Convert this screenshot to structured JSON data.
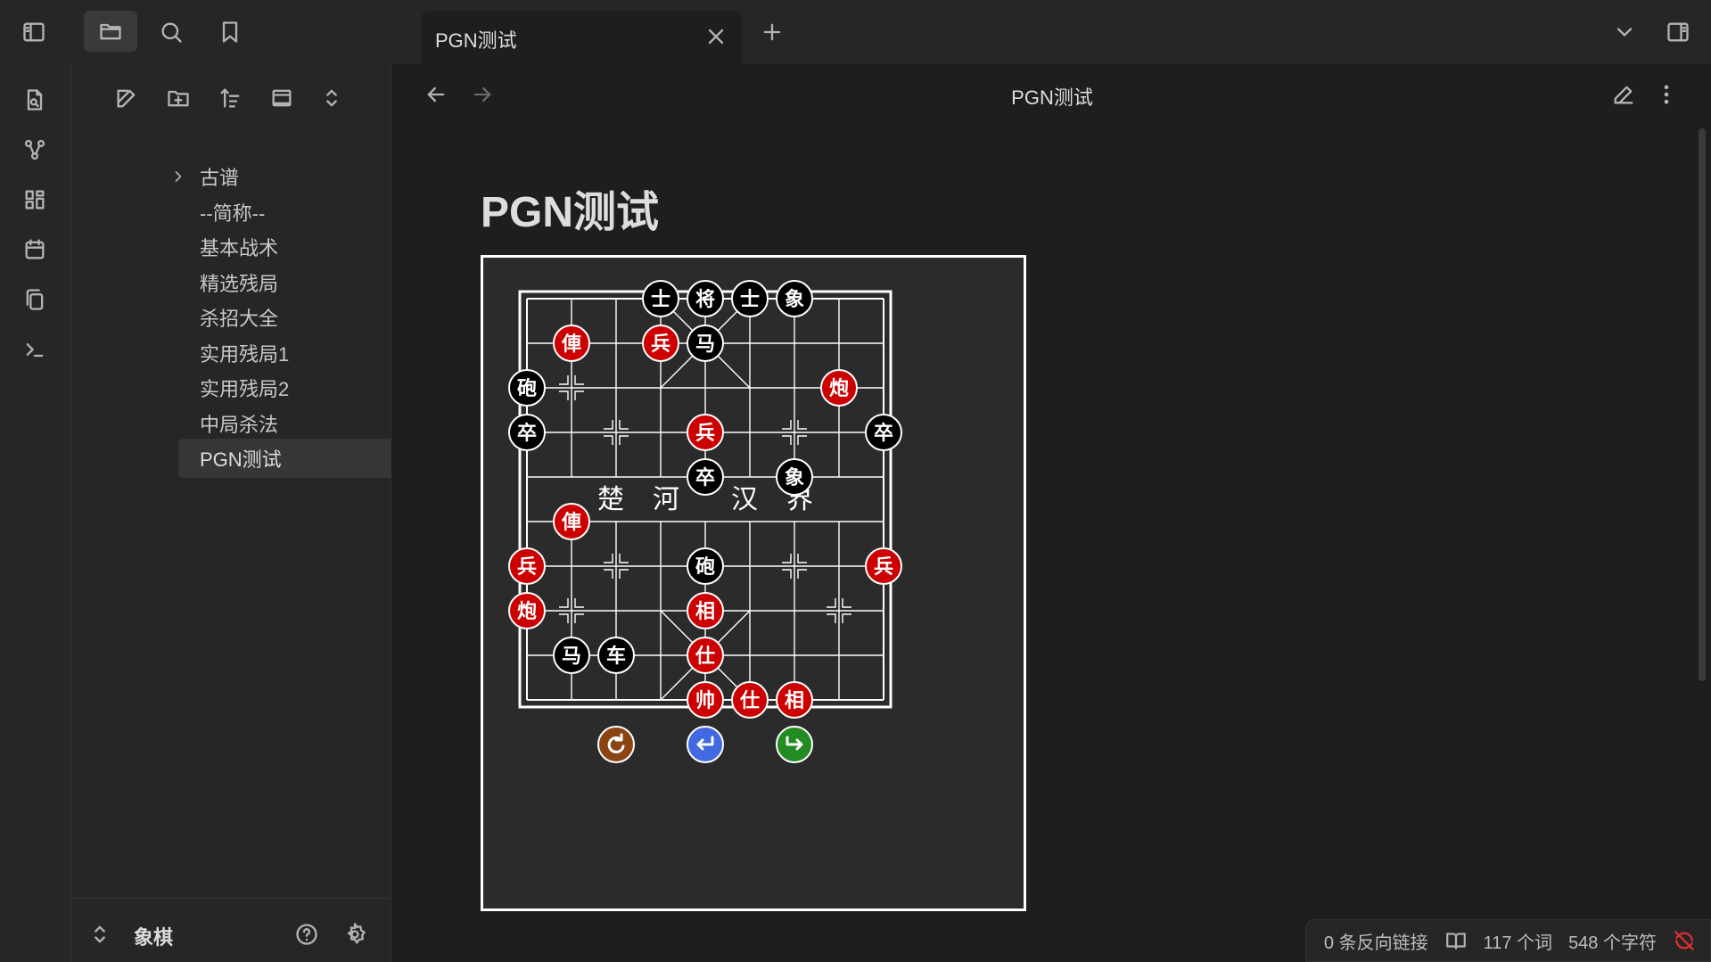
{
  "tab": {
    "title": "PGN测试"
  },
  "header": {
    "title": "PGN测试"
  },
  "note": {
    "title": "PGN测试"
  },
  "sidebar": {
    "vault_name": "象棋",
    "items": [
      {
        "label": "古谱",
        "folder": true
      },
      {
        "label": "--简称--"
      },
      {
        "label": "基本战术"
      },
      {
        "label": "精选残局"
      },
      {
        "label": "杀招大全"
      },
      {
        "label": "实用残局1"
      },
      {
        "label": "实用残局2"
      },
      {
        "label": "中局杀法"
      },
      {
        "label": "PGN测试",
        "active": true
      }
    ]
  },
  "board": {
    "river_left": [
      "楚",
      "河"
    ],
    "river_right": [
      "汉",
      "界"
    ],
    "pieces": [
      {
        "side": "b",
        "char": "士",
        "col": 3,
        "row": 0
      },
      {
        "side": "b",
        "char": "将",
        "col": 4,
        "row": 0
      },
      {
        "side": "b",
        "char": "士",
        "col": 5,
        "row": 0
      },
      {
        "side": "b",
        "char": "象",
        "col": 6,
        "row": 0
      },
      {
        "side": "r",
        "char": "俥",
        "col": 1,
        "row": 1
      },
      {
        "side": "r",
        "char": "兵",
        "col": 3,
        "row": 1
      },
      {
        "side": "b",
        "char": "马",
        "col": 4,
        "row": 1
      },
      {
        "side": "b",
        "char": "砲",
        "col": 0,
        "row": 2
      },
      {
        "side": "r",
        "char": "炮",
        "col": 7,
        "row": 2
      },
      {
        "side": "b",
        "char": "卒",
        "col": 0,
        "row": 3
      },
      {
        "side": "r",
        "char": "兵",
        "col": 4,
        "row": 3
      },
      {
        "side": "b",
        "char": "卒",
        "col": 8,
        "row": 3
      },
      {
        "side": "b",
        "char": "卒",
        "col": 4,
        "row": 4
      },
      {
        "side": "b",
        "char": "象",
        "col": 6,
        "row": 4
      },
      {
        "side": "r",
        "char": "俥",
        "col": 1,
        "row": 5
      },
      {
        "side": "r",
        "char": "兵",
        "col": 0,
        "row": 6
      },
      {
        "side": "b",
        "char": "砲",
        "col": 4,
        "row": 6
      },
      {
        "side": "r",
        "char": "兵",
        "col": 8,
        "row": 6
      },
      {
        "side": "r",
        "char": "炮",
        "col": 0,
        "row": 7
      },
      {
        "side": "r",
        "char": "相",
        "col": 4,
        "row": 7
      },
      {
        "side": "b",
        "char": "马",
        "col": 1,
        "row": 8
      },
      {
        "side": "b",
        "char": "车",
        "col": 2,
        "row": 8
      },
      {
        "side": "r",
        "char": "仕",
        "col": 4,
        "row": 8
      },
      {
        "side": "r",
        "char": "帅",
        "col": 4,
        "row": 9
      },
      {
        "side": "r",
        "char": "仕",
        "col": 5,
        "row": 9
      },
      {
        "side": "r",
        "char": "相",
        "col": 6,
        "row": 9
      }
    ],
    "controls": [
      {
        "name": "reset-button",
        "icon": "reset-icon",
        "color": "#8b4513"
      },
      {
        "name": "undo-button",
        "icon": "undo-icon",
        "color": "#4169e1"
      },
      {
        "name": "redo-button",
        "icon": "redo-icon",
        "color": "#228b22"
      }
    ]
  },
  "status": {
    "backlinks": "0 条反向链接",
    "words": "117 个词",
    "chars": "548 个字符"
  },
  "colors": {
    "red_piece": "#cc0000",
    "black_piece": "#000000",
    "accent_sync": "#e03030"
  }
}
